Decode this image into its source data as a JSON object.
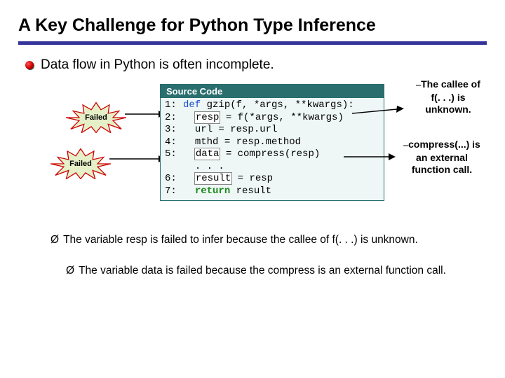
{
  "title": "A Key Challenge for Python Type Inference",
  "bullet": "Data flow in Python is often incomplete.",
  "bursts": {
    "b1": "Failed",
    "b2": "Failed"
  },
  "code": {
    "header": "Source Code",
    "lines": {
      "l1n": "1:",
      "l1a": "def ",
      "l1b": "gzip(f, *args, **kwargs):",
      "l2n": "2:",
      "l2a": "resp",
      "l2b": " = f(*args, **kwargs)",
      "l3n": "3:",
      "l3a": "url = resp.url",
      "l4n": "4:",
      "l4a": "mthd = resp.method",
      "l5n": "5:",
      "l5a": "data",
      "l5b": " = compress(resp)",
      "ldn": "",
      "lda": ". . .",
      "l6n": "6:",
      "l6a": "result",
      "l6b": " = resp",
      "l7n": "7:",
      "l7a": "return ",
      "l7b": "result"
    }
  },
  "annot": {
    "a1_dash": "–",
    "a1_rest1": "The callee of",
    "a1_line2": "f(. . .) is",
    "a1_line3": "unknown.",
    "a2_dash": "–",
    "a2_rest1": "compress(...) is",
    "a2_line2": "an external",
    "a2_line3": "function call."
  },
  "notes": {
    "mark": "Ø",
    "n1": "The variable resp is failed to infer because the callee of f(. . .) is unknown.",
    "n2": "The variable data is failed because the compress is an external function call."
  }
}
